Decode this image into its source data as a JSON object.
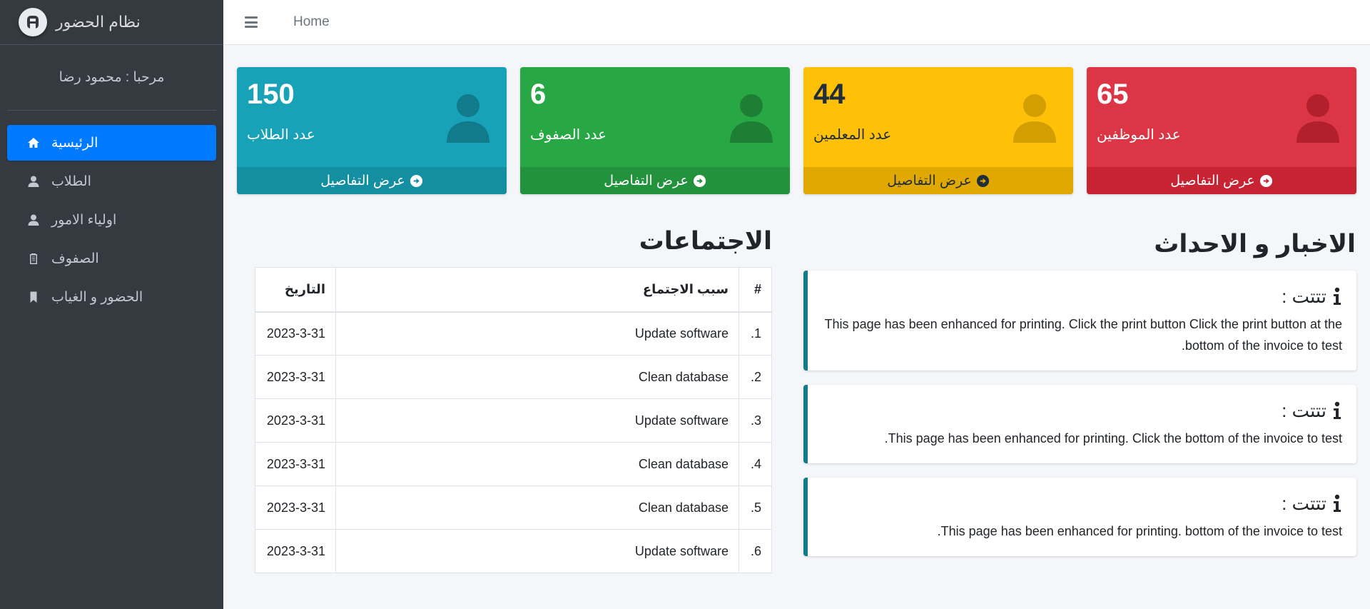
{
  "brand": {
    "name": "نظام الحضور",
    "logo_icon": "brand-logo-icon"
  },
  "user": {
    "greeting": "مرحبا : محمود رضا"
  },
  "sidebar": {
    "items": [
      {
        "label": "الرئيسية",
        "icon": "home-icon",
        "active": true
      },
      {
        "label": "الطلاب",
        "icon": "user-icon"
      },
      {
        "label": "اولياء الامور",
        "icon": "user-icon"
      },
      {
        "label": "الصفوف",
        "icon": "clipboard-icon"
      },
      {
        "label": "الحضور و الغياب",
        "icon": "bookmark-icon"
      }
    ]
  },
  "header": {
    "home": "Home"
  },
  "stats": [
    {
      "value": "150",
      "label": "عدد الطلاب",
      "link": "عرض التفاصيل",
      "color": "#17a2b8"
    },
    {
      "value": "6",
      "label": "عدد الصفوف",
      "link": "عرض التفاصيل",
      "color": "#28a745"
    },
    {
      "value": "44",
      "label": "عدد المعلمين",
      "link": "عرض التفاصيل",
      "color": "#ffc107"
    },
    {
      "value": "65",
      "label": "عدد الموظفين",
      "link": "عرض التفاصيل",
      "color": "#dc3545"
    }
  ],
  "meetings": {
    "title": "الاجتماعات",
    "headers": {
      "num": "#",
      "reason": "سبب الاجتماع",
      "date": "التاريخ"
    },
    "rows": [
      {
        "num": "1.",
        "reason": "Update software",
        "date": "2023-3-31"
      },
      {
        "num": "2.",
        "reason": "Clean database",
        "date": "2023-3-31"
      },
      {
        "num": "3.",
        "reason": "Update software",
        "date": "2023-3-31"
      },
      {
        "num": "4.",
        "reason": "Clean database",
        "date": "2023-3-31"
      },
      {
        "num": "5.",
        "reason": "Clean database",
        "date": "2023-3-31"
      },
      {
        "num": "6.",
        "reason": "Update software",
        "date": "2023-3-31"
      }
    ]
  },
  "news": {
    "title": "الاخبار و الاحداث",
    "items": [
      {
        "title": "تتتت :",
        "body": "This page has been enhanced for printing. Click the print button Click the print button at the bottom of the invoice to test."
      },
      {
        "title": "تتتت :",
        "body": "This page has been enhanced for printing. Click the bottom of the invoice to test."
      },
      {
        "title": "تتتت :",
        "body": "This page has been enhanced for printing. bottom of the invoice to test."
      }
    ]
  }
}
